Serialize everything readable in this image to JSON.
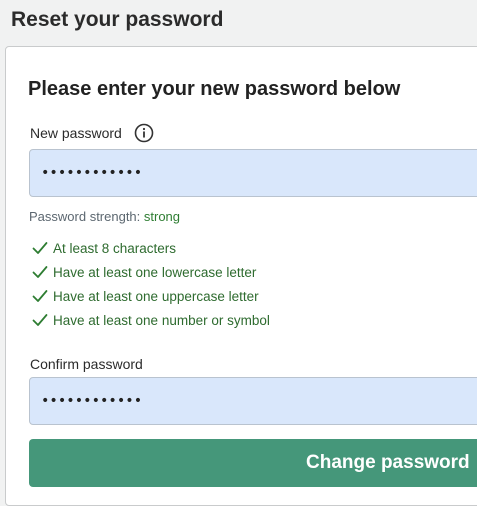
{
  "header": {
    "title": "Reset your password"
  },
  "form": {
    "heading": "Please enter your new password below",
    "new_password": {
      "label": "New password",
      "info_icon": "info-circle-icon",
      "value": "••••••••••••"
    },
    "strength": {
      "label": "Password strength: ",
      "value": "strong"
    },
    "requirements": [
      {
        "text": "At least 8 characters",
        "met": true
      },
      {
        "text": "Have at least one lowercase letter",
        "met": true
      },
      {
        "text": "Have at least one uppercase letter",
        "met": true
      },
      {
        "text": "Have at least one number or symbol",
        "met": true
      }
    ],
    "confirm_password": {
      "label": "Confirm password",
      "value": "••••••••••••"
    },
    "submit_label": "Change password"
  },
  "colors": {
    "input_background": "#d9e7fb",
    "success_text": "#2e7d32",
    "button_background": "#45977a"
  }
}
